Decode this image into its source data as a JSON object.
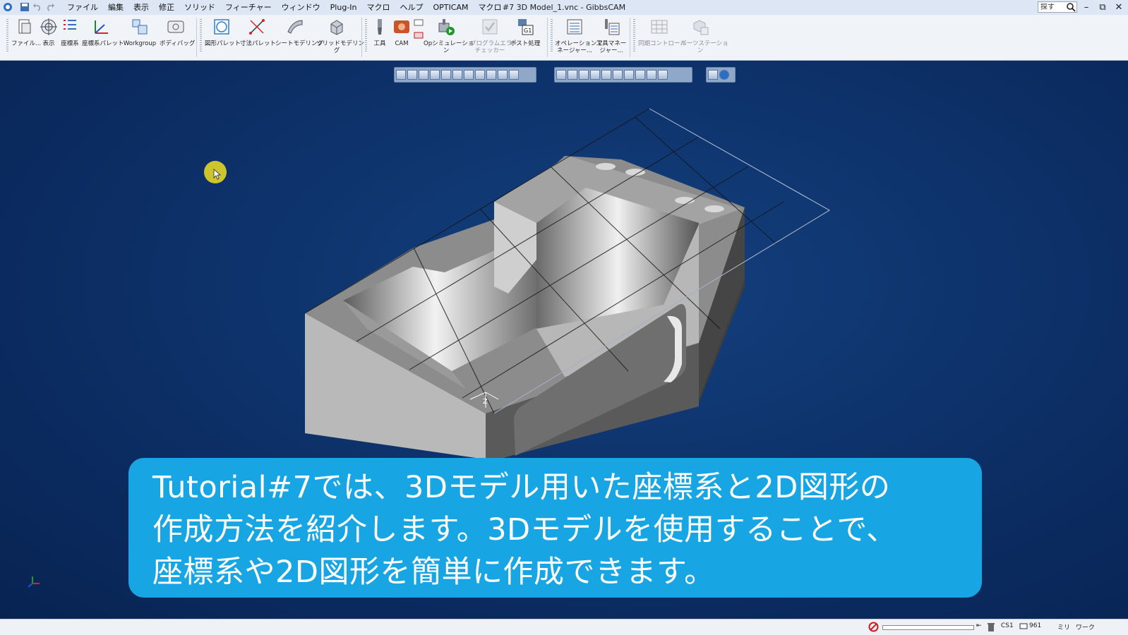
{
  "titlebar": {
    "title": "#7 3D Model_1.vnc - GibbsCAM",
    "search_placeholder": "探す"
  },
  "menu": [
    "ファイル",
    "編集",
    "表示",
    "修正",
    "ソリッド",
    "フィーチャー",
    "ウィンドウ",
    "Plug-In",
    "マクロ",
    "ヘルプ",
    "OPTICAM",
    "マクロ"
  ],
  "ribbon": {
    "file": "ファイル...",
    "display": "表示",
    "coord": "座標系",
    "coord_palette": "座標系パレット",
    "workgroup": "Workgroup",
    "body_bag": "ボディバッグ",
    "shape_palette": "図形パレット",
    "dim_palette": "寸法パレット",
    "sheet_modeling": "シートモデリング",
    "solid_modeling_1": "ソリッドモデリン",
    "solid_modeling_2": "グ",
    "tool": "工具",
    "cam": "CAM",
    "op_sim_1": "Opシミュレーショ",
    "op_sim_2": "ン",
    "program_error_1": "プログラムエラー",
    "program_error_2": "チェッカー",
    "post": "ポスト処理",
    "operation_mgr_1": "オペレーションマ",
    "operation_mgr_2": "ネージャー...",
    "tool_mgr_1": "工具マネー",
    "tool_mgr_2": "ジャー...",
    "sync_control": "同期コントロール",
    "part_station_1": "パーツステーショ",
    "part_station_2": "ン"
  },
  "viewport": {
    "axis_label": "Z"
  },
  "caption": {
    "line1": "Tutorial#7では、3Dモデル用いた座標系と2D図形の",
    "line2": "作成方法を紹介します。3Dモデルを使用することで、",
    "line3": "座標系や2D図形を簡単に作成できます。"
  },
  "statusbar": {
    "cs": "CS1",
    "count": "961",
    "unit": "ミリ",
    "work": "ワーク"
  },
  "colors": {
    "caption_bg": "#17a6e3",
    "viewport_bg": "#0c2f66",
    "cursor_highlight": "#ded228"
  }
}
